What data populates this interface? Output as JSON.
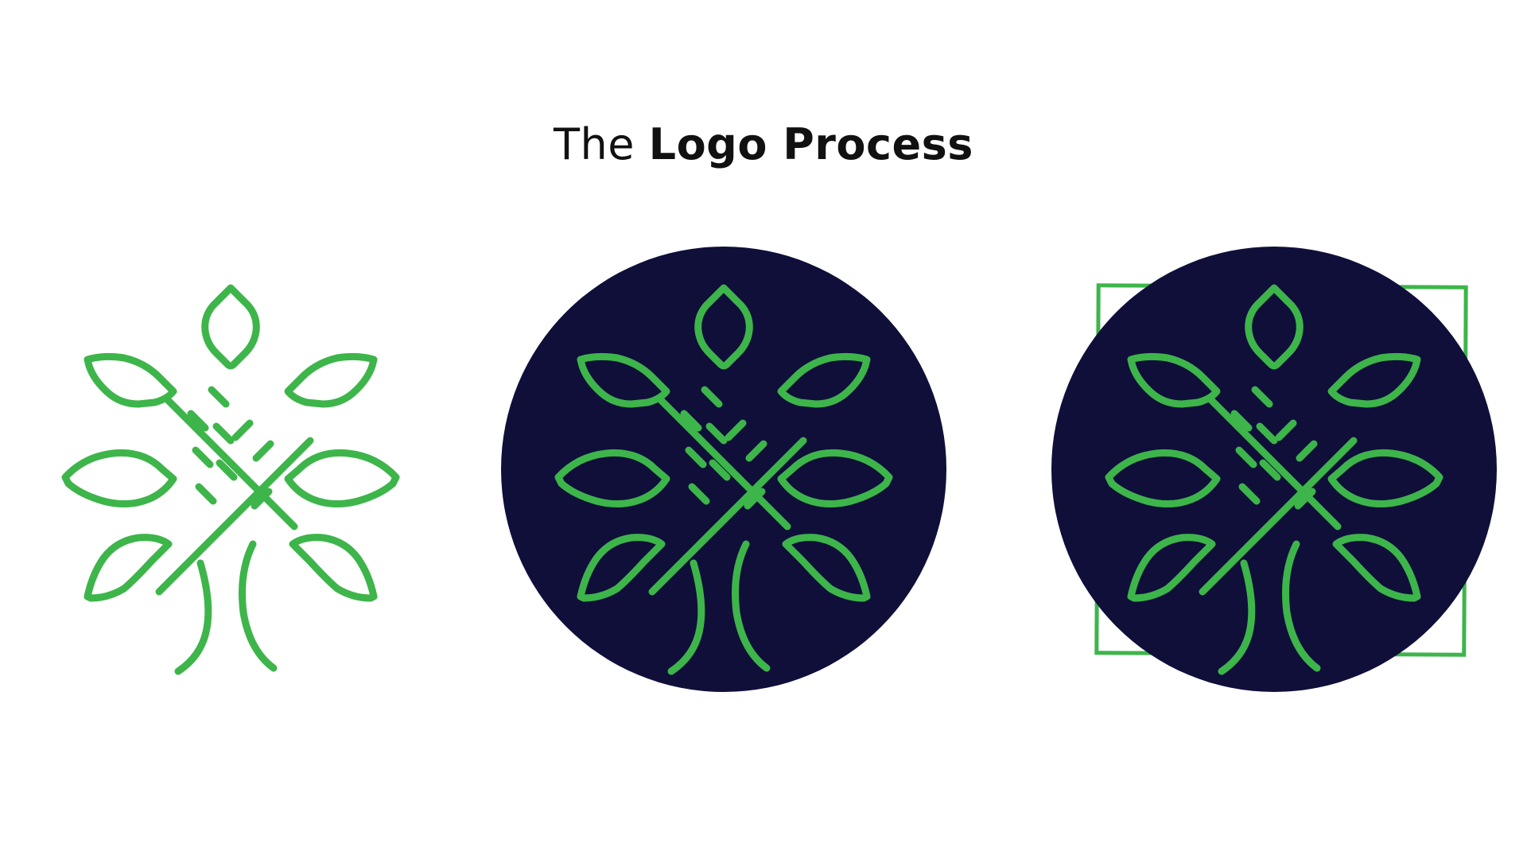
{
  "title": {
    "prefix": "The",
    "emphasis": "Logo Process"
  },
  "colors": {
    "background": "#ffffff",
    "leaf_green": "#3db54a",
    "circle_navy": "#0f0f3a",
    "title_text": "#111111"
  },
  "logos": [
    {
      "icon": "tree-leaves-icon",
      "variant": "outline-only"
    },
    {
      "icon": "tree-leaves-icon",
      "variant": "navy-circle"
    },
    {
      "icon": "tree-leaves-icon",
      "variant": "navy-circle-with-square-frame"
    }
  ]
}
